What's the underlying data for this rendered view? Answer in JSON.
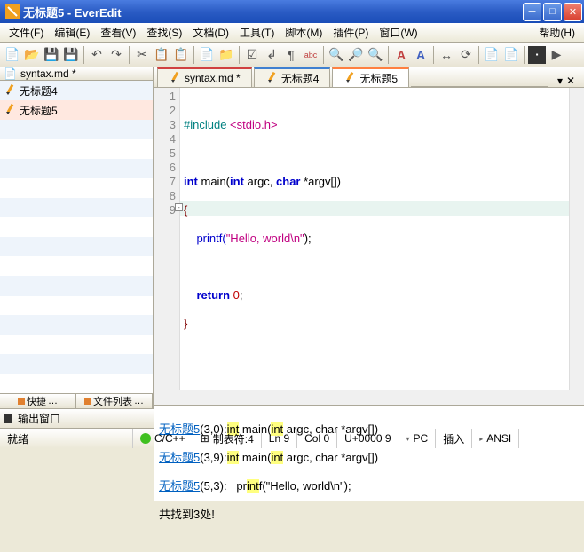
{
  "window": {
    "title": "无标题5 - EverEdit"
  },
  "menu": {
    "file": "文件(F)",
    "edit": "编辑(E)",
    "view": "查看(V)",
    "search": "查找(S)",
    "document": "文档(D)",
    "tools": "工具(T)",
    "script": "脚本(M)",
    "plugin": "插件(P)",
    "window": "窗口(W)",
    "help": "帮助(H)"
  },
  "sidebar": {
    "header": "syntax.md *",
    "items": [
      "无标题4",
      "无标题5"
    ],
    "tabs": {
      "quick": "快捷",
      "filelist": "文件列表"
    }
  },
  "tabs": [
    {
      "label": "syntax.md *"
    },
    {
      "label": "无标题4"
    },
    {
      "label": "无标题5"
    }
  ],
  "code": {
    "lines": [
      "1",
      "2",
      "3",
      "4",
      "5",
      "6",
      "7",
      "8",
      "9"
    ],
    "l1a": "#include ",
    "l1b": "<stdio.h>",
    "l3a": "int",
    "l3b": " main(",
    "l3c": "int",
    "l3d": " argc, ",
    "l3e": "char",
    "l3f": " *argv[])",
    "l4": "{",
    "l5a": "    printf(",
    "l5b": "\"Hello, world\\n\"",
    "l5c": ");",
    "l7a": "    ",
    "l7b": "return",
    "l7c": " ",
    "l7d": "0",
    "l7e": ";",
    "l8": "}"
  },
  "output": {
    "r1loc": "无标题5",
    "r1pos": "(3,0):",
    "r1a": "int",
    "r1b": " main(",
    "r1c": "int",
    "r1d": " argc, char *argv[])",
    "r2loc": "无标题5",
    "r2pos": "(3,9):",
    "r3loc": "无标题5",
    "r3pos": "(5,3):",
    "r3a": "   pr",
    "r3b": "int",
    "r3c": "f(\"Hello, world\\n\");",
    "summary": "共找到3处!",
    "tab": "输出窗口"
  },
  "status": {
    "ready": "就绪",
    "lang": "C/C++",
    "tab": "制表符:4",
    "ln": "Ln 9",
    "col": "Col 0",
    "unicode": "U+0000 9",
    "pc": "PC",
    "ins": "插入",
    "enc": "ANSI"
  }
}
